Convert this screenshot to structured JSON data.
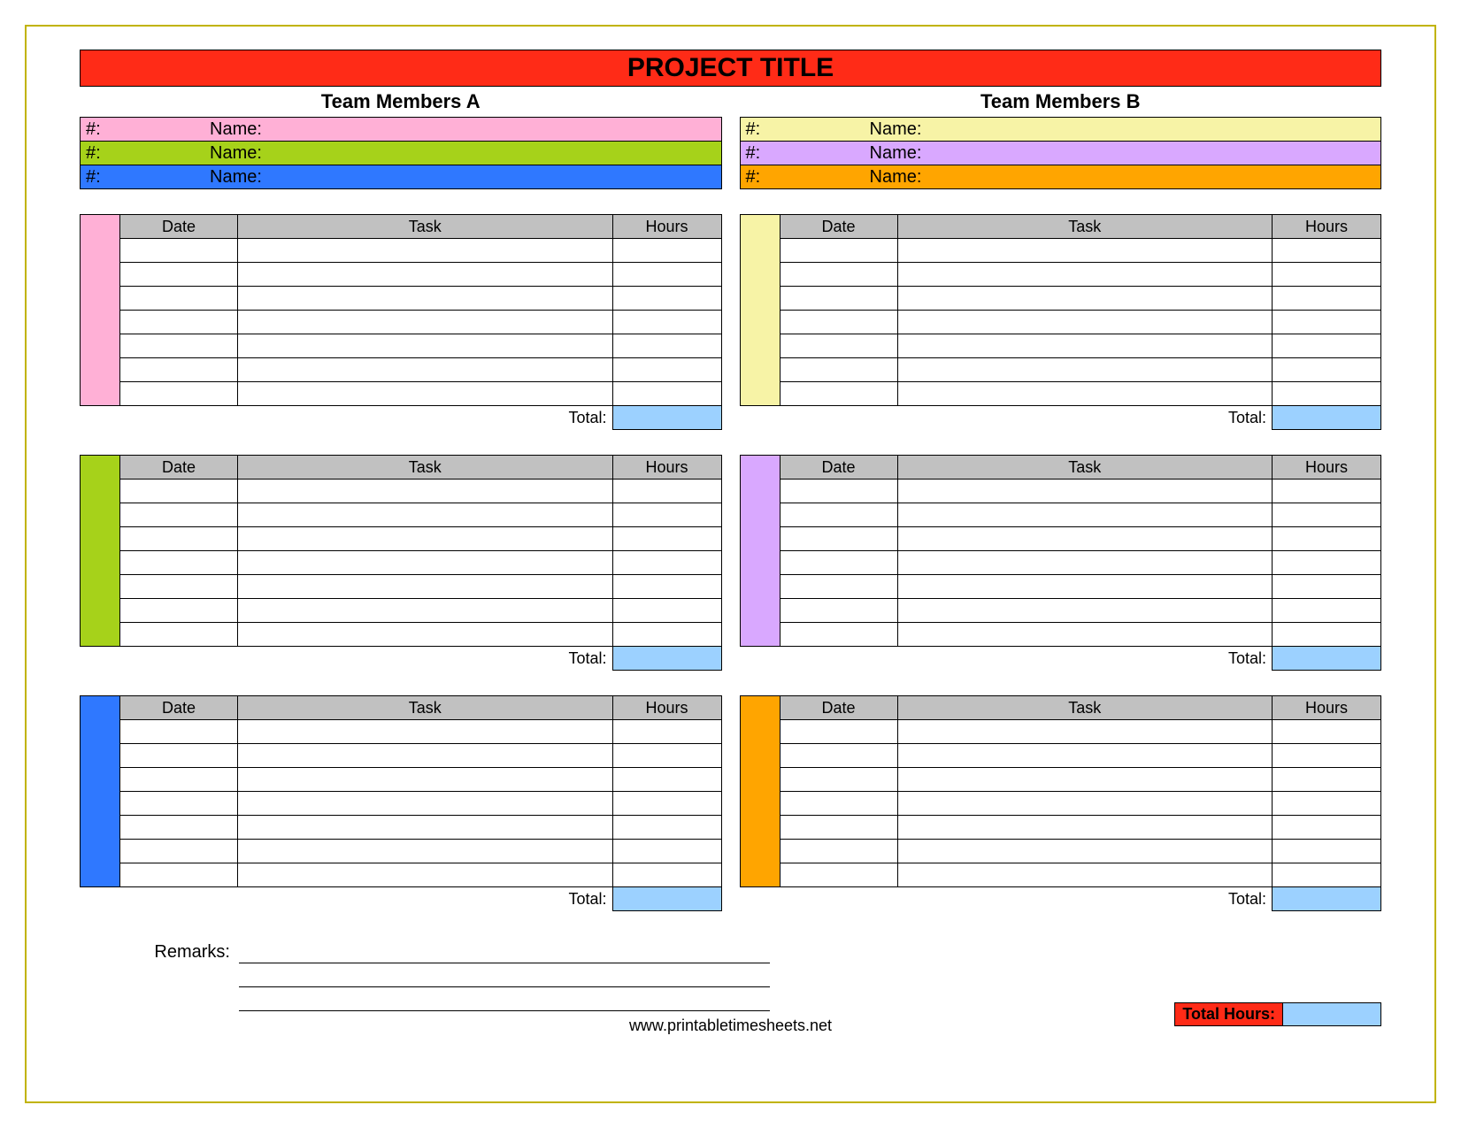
{
  "title": "PROJECT TITLE",
  "teamA": {
    "header": "Team Members A",
    "members": [
      {
        "num_label": "#:",
        "name_label": "Name:",
        "bg": "#ffb0d6"
      },
      {
        "num_label": "#:",
        "name_label": "Name:",
        "bg": "#a6d21a"
      },
      {
        "num_label": "#:",
        "name_label": "Name:",
        "bg": "#2f78ff"
      }
    ]
  },
  "teamB": {
    "header": "Team Members B",
    "members": [
      {
        "num_label": "#:",
        "name_label": "Name:",
        "bg": "#f7f3a6"
      },
      {
        "num_label": "#:",
        "name_label": "Name:",
        "bg": "#d9a8ff"
      },
      {
        "num_label": "#:",
        "name_label": "Name:",
        "bg": "#ffa500"
      }
    ]
  },
  "columns": {
    "date": "Date",
    "task": "Task",
    "hours": "Hours"
  },
  "total_label": "Total:",
  "block_colors_left": [
    "#ffb0d6",
    "#a6d21a",
    "#2f78ff"
  ],
  "block_colors_right": [
    "#f7f3a6",
    "#d9a8ff",
    "#ffa500"
  ],
  "data_rows": 7,
  "remarks_label": "Remarks:",
  "total_hours_label": "Total Hours:",
  "footer": "www.printabletimesheets.net"
}
